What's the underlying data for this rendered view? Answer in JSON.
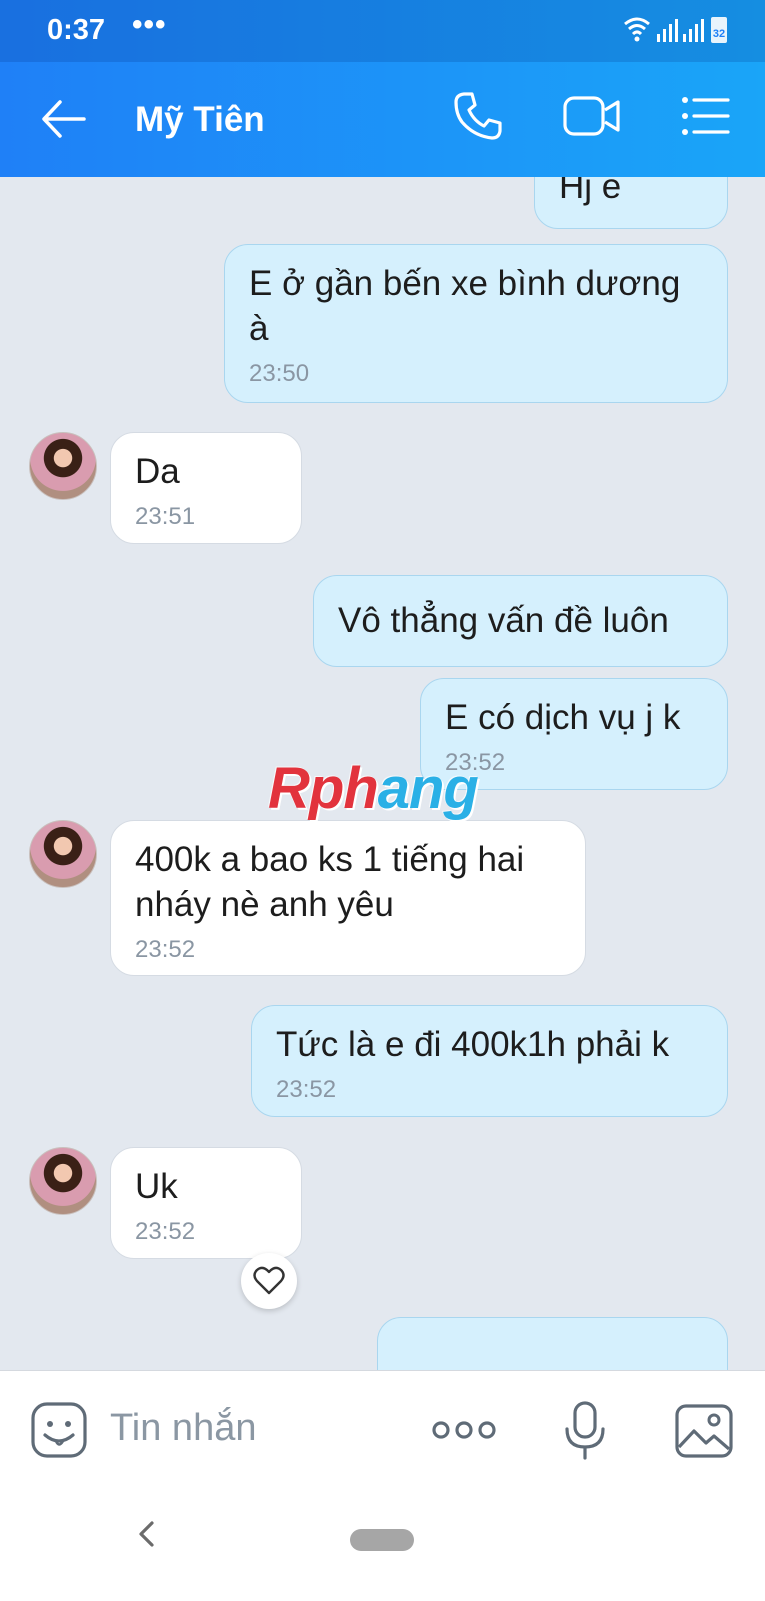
{
  "status_bar": {
    "time": "0:37",
    "more": "•••",
    "battery": "32"
  },
  "header": {
    "contact_name": "Mỹ Tiên"
  },
  "messages": [
    {
      "side": "out",
      "text": "Hj e",
      "time": ""
    },
    {
      "side": "out",
      "text": "E ở gần bến xe bình dương à",
      "time": "23:50"
    },
    {
      "side": "in",
      "text": "Da",
      "time": "23:51"
    },
    {
      "side": "out",
      "text": "Vô thẳng vấn đề luôn",
      "time": ""
    },
    {
      "side": "out",
      "text": "E có dịch vụ j k",
      "time": "23:52"
    },
    {
      "side": "in",
      "text": "400k a bao ks 1 tiếng hai nháy nè anh yêu",
      "time": "23:52"
    },
    {
      "side": "out",
      "text": "Tức là e đi 400k1h phải k",
      "time": "23:52"
    },
    {
      "side": "in",
      "text": "Uk",
      "time": "23:52"
    }
  ],
  "watermark": {
    "part1": "Rph",
    "part2": "ang"
  },
  "composer": {
    "placeholder": "Tin nhắn"
  },
  "icons": {
    "back": "arrow-left-icon",
    "call": "phone-icon",
    "video": "video-camera-icon",
    "menu": "list-menu-icon",
    "sticker": "sticker-smiley-icon",
    "more": "more-options-icon",
    "mic": "microphone-icon",
    "image": "image-gallery-icon",
    "reaction": "heart-icon"
  },
  "colors": {
    "header_start": "#1f80f7",
    "header_end": "#1aa5f8",
    "outgoing_bubble": "#d5f0fd",
    "incoming_bubble": "#ffffff",
    "chat_background": "#e3e8ef"
  }
}
